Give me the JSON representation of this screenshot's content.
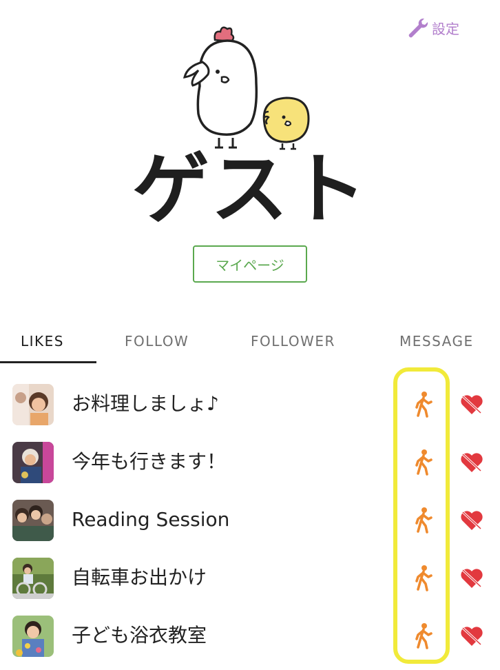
{
  "header": {
    "settings_label": "設定"
  },
  "profile": {
    "name": "ゲスト",
    "mypage_label": "マイページ"
  },
  "tabs": [
    {
      "label": "LIKES",
      "active": true
    },
    {
      "label": "FOLLOW",
      "active": false
    },
    {
      "label": "FOLLOWER",
      "active": false
    },
    {
      "label": "MESSAGE",
      "active": false
    }
  ],
  "likes": [
    {
      "title": "お料理しましょ♪"
    },
    {
      "title": "今年も行きます！"
    },
    {
      "title": "Reading Session"
    },
    {
      "title": "自転車お出かけ"
    },
    {
      "title": "子ども浴衣教室"
    }
  ],
  "colors": {
    "accent_green": "#5aa84e",
    "settings_purple": "#b27fcc",
    "walk_orange": "#ef8a2e",
    "heart_red": "#e2393f",
    "highlight_yellow": "#f1ea3a"
  },
  "icons": {
    "settings": "wrench-icon",
    "walk": "walking-person-icon",
    "unlike": "broken-heart-icon"
  }
}
